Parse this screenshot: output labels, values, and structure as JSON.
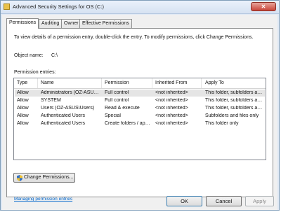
{
  "window": {
    "title": "Advanced Security Settings for OS (C:)"
  },
  "tabs": [
    {
      "label": "Permissions"
    },
    {
      "label": "Auditing"
    },
    {
      "label": "Owner"
    },
    {
      "label": "Effective Permissions"
    }
  ],
  "permissions": {
    "info": "To view details of a permission entry, double-click the entry. To modify permissions, click Change Permissions.",
    "object_name_label": "Object name:",
    "object_name_value": "C:\\",
    "entries_label": "Permission entries:",
    "columns": [
      "Type",
      "Name",
      "Permission",
      "Inherited From",
      "Apply To"
    ],
    "rows": [
      {
        "type": "Allow",
        "name": "Administrators (OZ-ASUS\\...",
        "permission": "Full control",
        "inherited": "<not inherited>",
        "apply_to": "This folder, subfolders and..."
      },
      {
        "type": "Allow",
        "name": "SYSTEM",
        "permission": "Full control",
        "inherited": "<not inherited>",
        "apply_to": "This folder, subfolders and..."
      },
      {
        "type": "Allow",
        "name": "Users (OZ-ASUS\\Users)",
        "permission": "Read & execute",
        "inherited": "<not inherited>",
        "apply_to": "This folder, subfolders and..."
      },
      {
        "type": "Allow",
        "name": "Authenticated Users",
        "permission": "Special",
        "inherited": "<not inherited>",
        "apply_to": "Subfolders and files only"
      },
      {
        "type": "Allow",
        "name": "Authenticated Users",
        "permission": "Create folders / app...",
        "inherited": "<not inherited>",
        "apply_to": "This folder only"
      }
    ],
    "change_button": "Change Permissions...",
    "help_link": "Managing permission entries"
  },
  "buttons": {
    "ok": "OK",
    "cancel": "Cancel",
    "apply": "Apply"
  }
}
